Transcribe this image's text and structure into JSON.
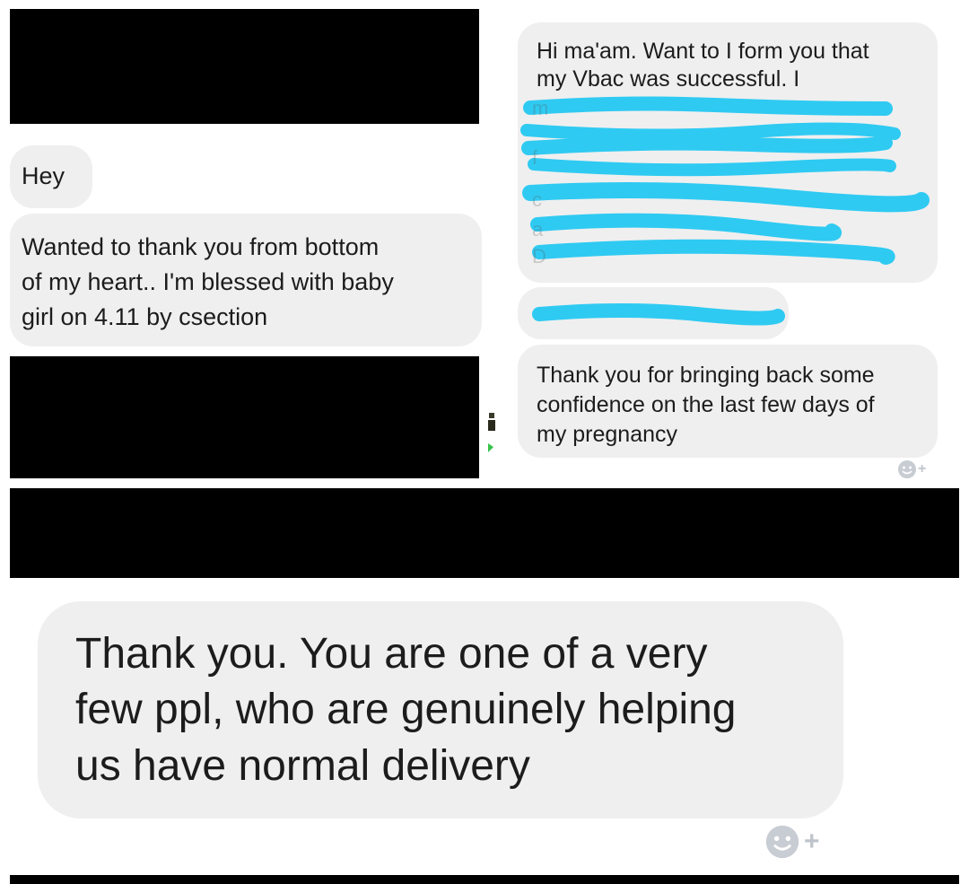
{
  "left_column": {
    "messages": [
      {
        "text": "Hey"
      },
      {
        "text_lines": [
          "Wanted to thank you from bottom",
          "of my heart.. I'm blessed with baby",
          "girl on 4.11 by csection"
        ]
      }
    ]
  },
  "right_column": {
    "messages": [
      {
        "visible_lines": [
          "Hi ma'am. Want to I form you that",
          "my Vbac was successful. I"
        ]
      },
      {
        "text_lines": [
          "Thank you for bringing back some",
          "confidence on the last few days of",
          "my pregnancy"
        ]
      }
    ],
    "reaction_icon": "smiley-add-reaction-icon"
  },
  "bottom": {
    "message_lines": [
      "Thank you. You are one of a very",
      "few ppl, who are genuinely helping",
      "us have normal delivery"
    ],
    "reaction_icon": "smiley-add-reaction-icon"
  },
  "colors": {
    "bubble": "#efefef",
    "redaction_black": "#000000",
    "scribble_blue": "#2fcaf2",
    "reaction_gray": "#bfc4cc"
  }
}
